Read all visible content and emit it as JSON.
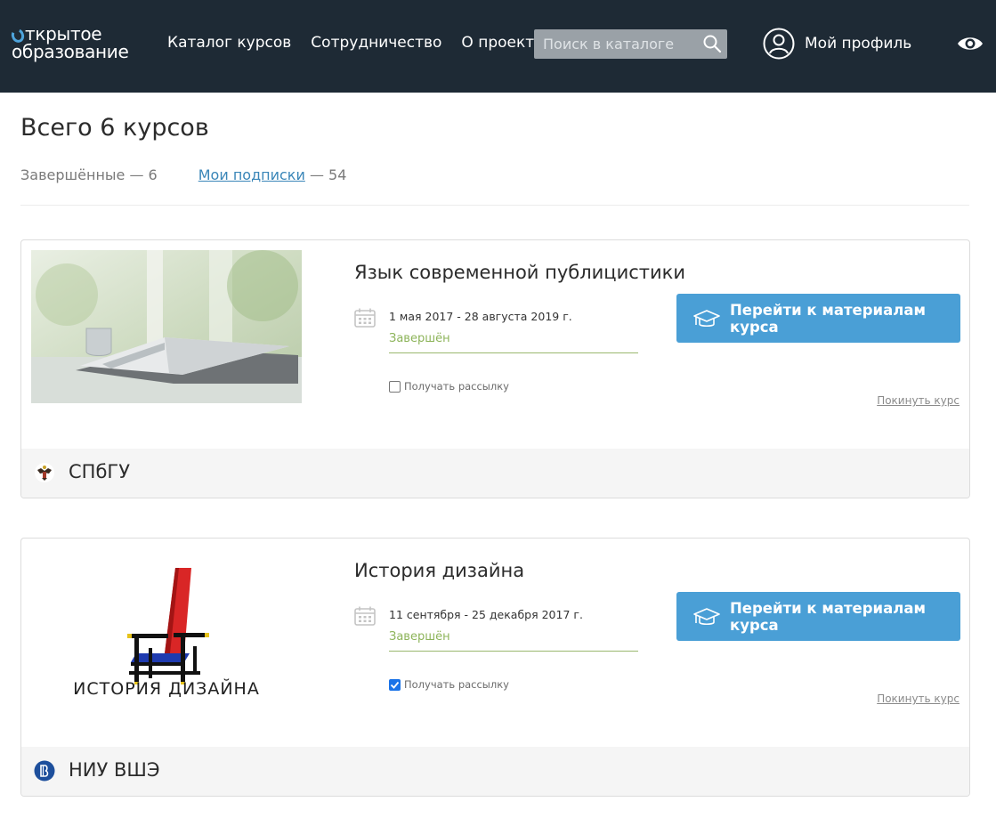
{
  "header": {
    "logo_line1": "ткрытое",
    "logo_line2": "образование",
    "nav": [
      "Каталог курсов",
      "Сотрудничество",
      "О проекте"
    ],
    "search_placeholder": "Поиск в каталоге",
    "profile_label": "Мой профиль"
  },
  "page": {
    "title": "Всего 6 курсов",
    "filters": {
      "completed_label": "Завершённые",
      "completed_count": "— 6",
      "subs_label": "Мои подписки",
      "subs_count": "— 54"
    }
  },
  "courses": [
    {
      "title": "Язык современной публицистики",
      "dates": "1 мая 2017 - 28 августа 2019 г.",
      "status": "Завершён",
      "subscribe_label": "Получать рассылку",
      "subscribed": false,
      "button_label": "Перейти к материалам курса",
      "leave_label": "Покинуть курс",
      "university": "СПбГУ"
    },
    {
      "title": "История дизайна",
      "dates": "11 сентября - 25 декабря 2017 г.",
      "status": "Завершён",
      "subscribe_label": "Получать рассылку",
      "subscribed": true,
      "button_label": "Перейти к материалам курса",
      "leave_label": "Покинуть курс",
      "university": "НИУ ВШЭ",
      "image_caption": "ИСТОРИЯ ДИЗАЙНА"
    }
  ],
  "colors": {
    "header_bg": "#1e2a35",
    "accent_blue": "#4a9fd6",
    "status_green": "#8db45a",
    "link_blue": "#3a86b8"
  }
}
